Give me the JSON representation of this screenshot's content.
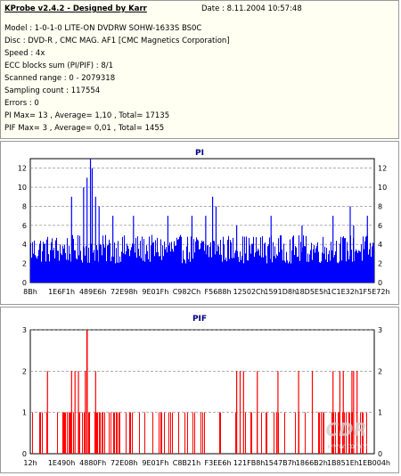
{
  "info": {
    "title": "KProbe v2.4.2 - Designed by Karr",
    "date": "Date : 8.11.2004 10:57:48",
    "lines": [
      "Model : 1-0-1-0 LITE-ON DVDRW SOHW-1633S BS0C",
      "Disc : DVD-R , CMC MAG. AF1 [CMC Magnetics Corporation]",
      "Speed : 4x",
      "ECC blocks sum (PI/PIF) : 8/1",
      "Scanned range : 0 - 2079318",
      "Sampling count : 117554",
      "Errors : 0",
      "PI Max= 13 , Average= 1,10 , Total= 17135",
      "PIF Max= 3 , Average= 0,01 , Total= 1455"
    ]
  },
  "watermark": "CDR",
  "watermark_url": "www.cdr.cz",
  "chart_data": [
    {
      "type": "bar",
      "title": "PI",
      "color": "#0000ff",
      "ylim": [
        0,
        13
      ],
      "yticks": [
        0,
        2,
        4,
        6,
        8,
        10,
        12
      ],
      "xticks": [
        "8Bh",
        "1E6F1h",
        "489E6h",
        "72E98h",
        "9E01Fh",
        "C982Ch",
        "F5688h",
        "12502Ch",
        "1591D8h",
        "18D5E5h",
        "1C1E32h",
        "1F5E72h"
      ],
      "baseline_range": [
        2,
        5
      ],
      "spikes": [
        {
          "pos": 0.12,
          "value": 9
        },
        {
          "pos": 0.155,
          "value": 10
        },
        {
          "pos": 0.165,
          "value": 11
        },
        {
          "pos": 0.175,
          "value": 13
        },
        {
          "pos": 0.18,
          "value": 12
        },
        {
          "pos": 0.19,
          "value": 9
        },
        {
          "pos": 0.2,
          "value": 8
        },
        {
          "pos": 0.24,
          "value": 7
        },
        {
          "pos": 0.3,
          "value": 7
        },
        {
          "pos": 0.4,
          "value": 7
        },
        {
          "pos": 0.47,
          "value": 7
        },
        {
          "pos": 0.51,
          "value": 7
        },
        {
          "pos": 0.53,
          "value": 9
        },
        {
          "pos": 0.54,
          "value": 8
        },
        {
          "pos": 0.6,
          "value": 6
        },
        {
          "pos": 0.7,
          "value": 7
        },
        {
          "pos": 0.79,
          "value": 6
        },
        {
          "pos": 0.88,
          "value": 7
        },
        {
          "pos": 0.93,
          "value": 8
        },
        {
          "pos": 0.94,
          "value": 6
        },
        {
          "pos": 0.98,
          "value": 7
        }
      ]
    },
    {
      "type": "bar",
      "title": "PIF",
      "color": "#ff0000",
      "ylim": [
        0,
        3
      ],
      "yticks": [
        0,
        1,
        2,
        3
      ],
      "xticks": [
        "12h",
        "1E490h",
        "4880Fh",
        "72E08h",
        "9E01Fh",
        "C8B21h",
        "F3EE6h",
        "121FB8h",
        "1547B7h",
        "1866B2h",
        "1B851Eh",
        "1EB004h"
      ],
      "ones_density": 0.25,
      "twos": [
        0.05,
        0.12,
        0.13,
        0.14,
        0.16,
        0.19,
        0.6,
        0.61,
        0.62,
        0.66,
        0.72,
        0.78,
        0.82,
        0.88,
        0.9,
        0.91,
        0.935,
        0.94,
        0.95
      ],
      "threes": [
        0.165
      ]
    }
  ]
}
